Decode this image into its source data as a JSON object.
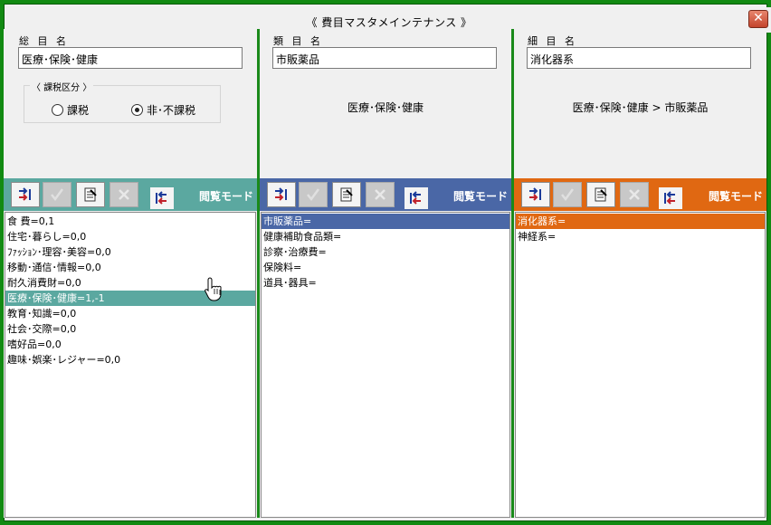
{
  "window": {
    "title": "《 費目マスタメインテナンス 》",
    "close": "✕"
  },
  "columns": [
    {
      "label": "総 目 名",
      "value": "医療･保険･健康",
      "tax": {
        "legend": "〈 課税区分 〉",
        "options": [
          {
            "label": "課税",
            "selected": false
          },
          {
            "label": "非･不課税",
            "selected": true
          }
        ]
      },
      "mode": "閲覧モード",
      "toolbar_color": "#5ba8a0",
      "items": [
        "食 費=0,1",
        "住宅･暮らし=0,0",
        "ﾌｧｯｼｮﾝ･理容･美容=0,0",
        "移動･通信･情報=0,0",
        "耐久消費財=0,0",
        "医療･保険･健康=1,-1",
        "教育･知識=0,0",
        "社会･交際=0,0",
        "嗜好品=0,0",
        "趣味･娯楽･レジャー=0,0"
      ],
      "selected_index": 5
    },
    {
      "label": "類 目 名",
      "value": "市販薬品",
      "path": "医療･保険･健康",
      "mode": "閲覧モード",
      "toolbar_color": "#4a67a6",
      "items": [
        "市販薬品=",
        "健康補助食品類=",
        "診察･治療費=",
        "保険料=",
        "道具･器具="
      ],
      "selected_index": 0
    },
    {
      "label": "細 目 名",
      "value": "消化器系",
      "path": "医療･保険･健康 > 市販薬品",
      "mode": "閲覧モード",
      "toolbar_color": "#e06812",
      "items": [
        "消化器系=",
        "神経系="
      ],
      "selected_index": 0
    }
  ]
}
